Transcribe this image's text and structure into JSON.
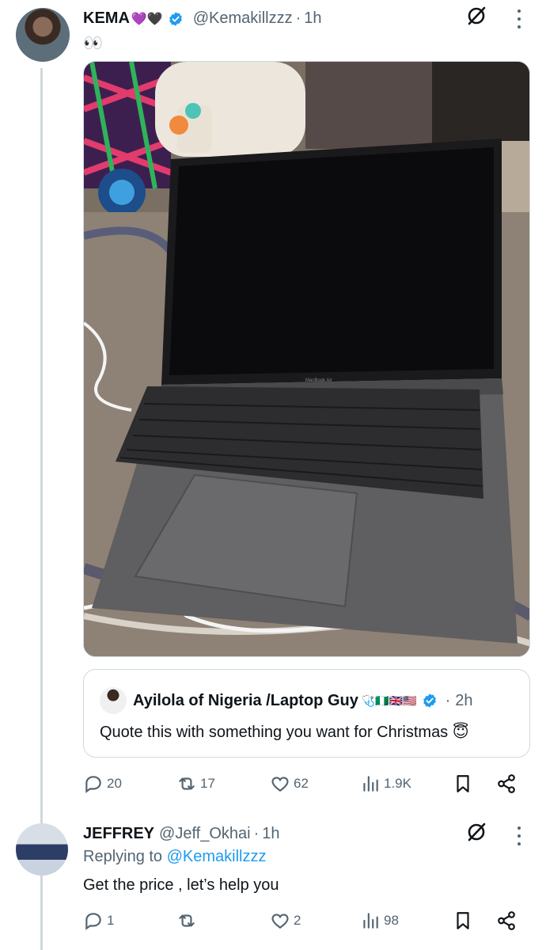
{
  "tweet": {
    "author_name": "KEMA",
    "author_emojis": "💜🖤",
    "handle": "@Kemakillzzz",
    "time": "1h",
    "text": "👀",
    "quote": {
      "author_name": "Ayilola of Nigeria /Laptop Guy",
      "author_emojis": "🩺🇳🇬🇬🇧🇺🇸",
      "time": "2h",
      "text": "Quote this with something you want  for Christmas 😇"
    },
    "stats": {
      "replies": "20",
      "reposts": "17",
      "likes": "62",
      "views": "1.9K"
    },
    "media_laptop_brand": "MacBook Air"
  },
  "reply": {
    "author_name": "JEFFREY",
    "handle": "@Jeff_Okhai",
    "time": "1h",
    "replying_label": "Replying to",
    "replying_to": "@Kemakillzzz",
    "text": "Get the price , let’s help you",
    "stats": {
      "replies": "1",
      "reposts": "",
      "likes": "2",
      "views": "98"
    }
  },
  "colors": {
    "verified": "#1d9bf0",
    "secondary_text": "#536471",
    "link": "#1d9bf0",
    "border": "#cfd9de"
  },
  "icons": [
    "grok-icon",
    "more-icon",
    "verified-badge-icon",
    "reply-icon",
    "repost-icon",
    "like-icon",
    "views-icon",
    "bookmark-icon",
    "share-icon"
  ]
}
